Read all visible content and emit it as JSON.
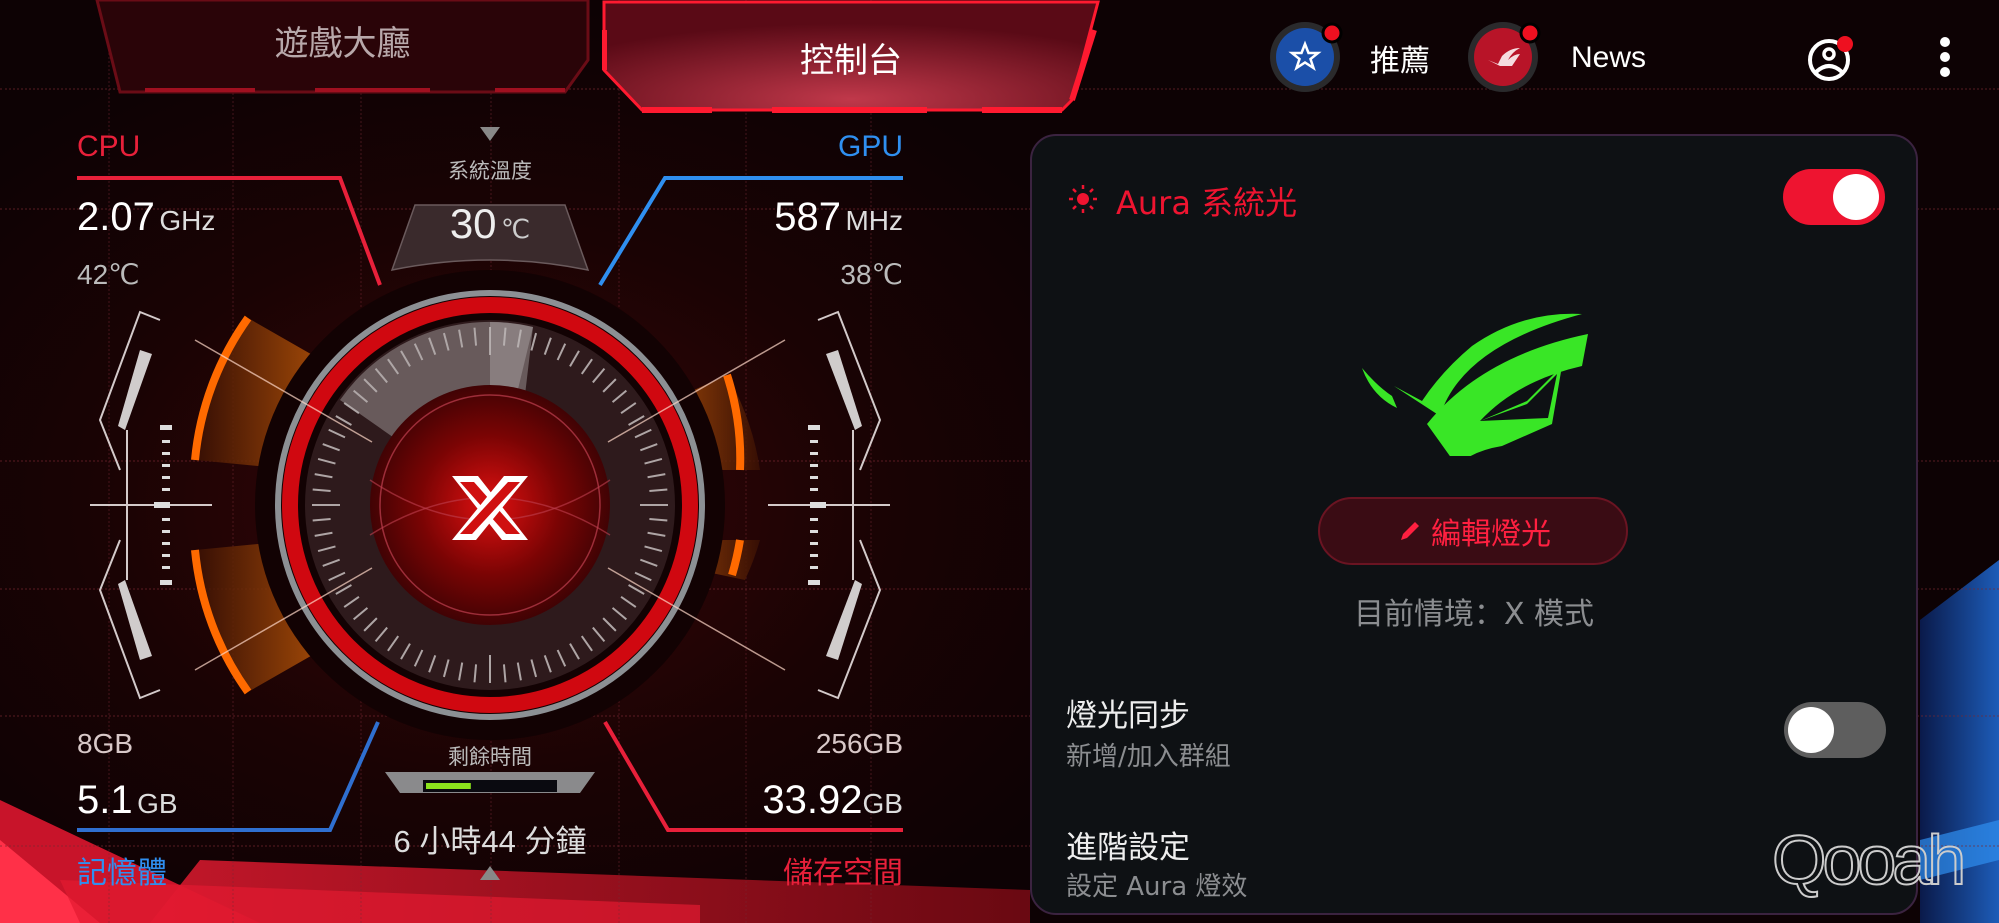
{
  "colors": {
    "accent_red": "#ee1430",
    "gpu_blue": "#2f8ff0",
    "aura_green": "#39e626",
    "battery_green": "#8be21c"
  },
  "tabs": [
    {
      "label": "遊戲大廳",
      "active": false
    },
    {
      "label": "控制台",
      "active": true
    }
  ],
  "header": {
    "recommend": {
      "label": "推薦",
      "icon": "star-icon",
      "badge": true
    },
    "news": {
      "label": "News",
      "icon": "rog-logo-icon",
      "badge": true
    },
    "profile": {
      "icon": "profile-icon",
      "badge": true
    },
    "menu": {
      "icon": "more-vertical-icon"
    }
  },
  "dashboard": {
    "cpu": {
      "label": "CPU",
      "freq_value": "2.07",
      "freq_unit": "GHz",
      "temp": "42℃"
    },
    "gpu": {
      "label": "GPU",
      "freq_value": "587",
      "freq_unit": "MHz",
      "temp": "38℃"
    },
    "system_temp": {
      "label": "系統溫度",
      "value": "30",
      "unit": "℃"
    },
    "memory": {
      "label": "記憶體",
      "total": "8GB",
      "used_value": "5.1",
      "used_unit": "GB"
    },
    "storage": {
      "label": "儲存空間",
      "total": "256GB",
      "used_value": "33.92",
      "used_unit": "GB"
    },
    "remaining_time": {
      "label": "剩餘時間",
      "value": "6 小時44 分鐘",
      "battery_fraction": 0.35
    },
    "center_logo": "X"
  },
  "aura_panel": {
    "title": "Aura 系統光",
    "title_icon": "sun-icon",
    "enabled": true,
    "edit_button": "編輯燈光",
    "current_mode": "目前情境：X 模式",
    "sync": {
      "title": "燈光同步",
      "subtitle": "新增/加入群組",
      "enabled": false
    },
    "advanced": {
      "title": "進階設定",
      "subtitle": "設定 Aura 燈效"
    }
  },
  "watermark": "Qooah"
}
